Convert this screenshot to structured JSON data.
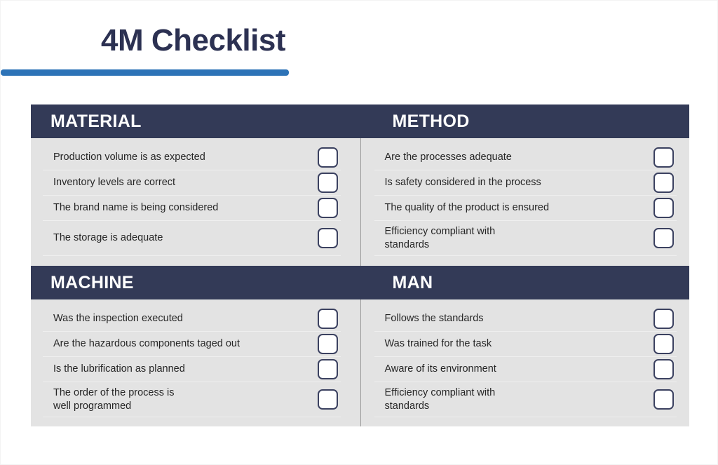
{
  "document": {
    "title": "4M Checklist",
    "accent_bar_color": "#2d73b7",
    "header_band_color": "#333a57",
    "panel_background_color": "#e3e3e3",
    "title_color": "#2c3152"
  },
  "quadrants": [
    {
      "heading": "MATERIAL",
      "items": [
        {
          "label": "Production volume is as expected",
          "checked": false,
          "tall": false
        },
        {
          "label": "Inventory levels are correct",
          "checked": false,
          "tall": false
        },
        {
          "label": "The brand name is being considered",
          "checked": false,
          "tall": false
        },
        {
          "label": "The storage is adequate",
          "checked": false,
          "tall": true
        }
      ]
    },
    {
      "heading": "METHOD",
      "items": [
        {
          "label": "Are the processes adequate",
          "checked": false,
          "tall": false
        },
        {
          "label": "Is safety considered in the process",
          "checked": false,
          "tall": false
        },
        {
          "label": "The quality of the product is ensured",
          "checked": false,
          "tall": false
        },
        {
          "label": "Efficiency compliant with\nstandards",
          "checked": false,
          "tall": true
        }
      ]
    },
    {
      "heading": "MACHINE",
      "items": [
        {
          "label": "Was the inspection executed",
          "checked": false,
          "tall": false
        },
        {
          "label": "Are the hazardous components  taged out",
          "checked": false,
          "tall": false
        },
        {
          "label": "Is the lubrification as planned",
          "checked": false,
          "tall": false
        },
        {
          "label": "The order of the process is\nwell programmed",
          "checked": false,
          "tall": true
        }
      ]
    },
    {
      "heading": "MAN",
      "items": [
        {
          "label": "Follows the standards",
          "checked": false,
          "tall": false
        },
        {
          "label": "Was trained for the task",
          "checked": false,
          "tall": false
        },
        {
          "label": "Aware of its environment",
          "checked": false,
          "tall": false
        },
        {
          "label": "Efficiency compliant with\nstandards",
          "checked": false,
          "tall": true
        }
      ]
    }
  ]
}
